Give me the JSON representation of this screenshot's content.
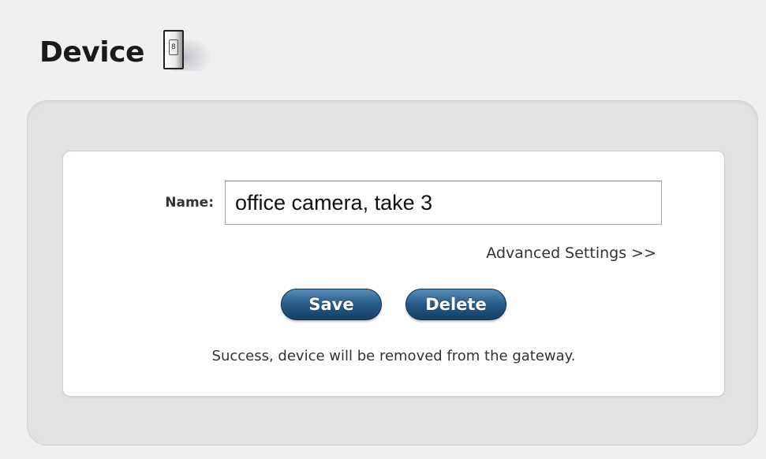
{
  "header": {
    "title": "Device",
    "icon": "device-icon",
    "icon_glyph": "8"
  },
  "form": {
    "name_label": "Name:",
    "name_value": "office camera, take 3",
    "advanced_link": "Advanced Settings >>",
    "save_label": "Save",
    "delete_label": "Delete",
    "status_message": "Success, device will be removed from the gateway."
  },
  "colors": {
    "button_primary": "#2a5f8c",
    "background": "#f0f0f0",
    "panel": "#e3e3e3",
    "card": "#ffffff"
  }
}
